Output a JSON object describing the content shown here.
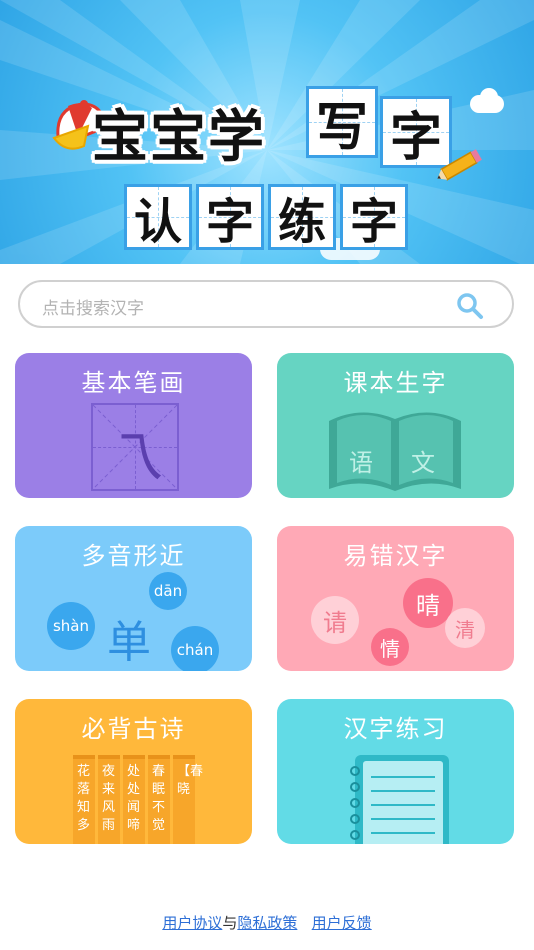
{
  "banner": {
    "title_plain": "宝宝学",
    "title_grid": [
      "写",
      "字"
    ],
    "subtitle_grid": [
      "认",
      "字",
      "练",
      "字"
    ]
  },
  "search": {
    "placeholder": "点击搜索汉字"
  },
  "cards": [
    {
      "label": "基本笔画",
      "glyph": "乁"
    },
    {
      "label": "课本生字",
      "book_left": "语",
      "book_right": "文"
    },
    {
      "label": "多音形近",
      "main": "单",
      "pinyin": [
        "dān",
        "shàn",
        "chán"
      ]
    },
    {
      "label": "易错汉字",
      "chars": [
        "请",
        "晴",
        "情",
        "清"
      ]
    },
    {
      "label": "必背古诗",
      "poems": [
        "花落知多",
        "夜来风雨",
        "处处闻啼",
        "春眠不觉",
        "【春晓"
      ]
    },
    {
      "label": "汉字练习"
    }
  ],
  "footer": {
    "agreement": "用户协议",
    "and": "与",
    "privacy": "隐私政策",
    "feedback": "用户反馈"
  },
  "colors": {
    "purple": "#9b7fe6",
    "teal": "#66d4c2",
    "sky": "#7ccbfa",
    "pink": "#ffa9b6",
    "orange": "#ffb83b",
    "cyan": "#62dbe6",
    "link": "#2e6fd6"
  }
}
